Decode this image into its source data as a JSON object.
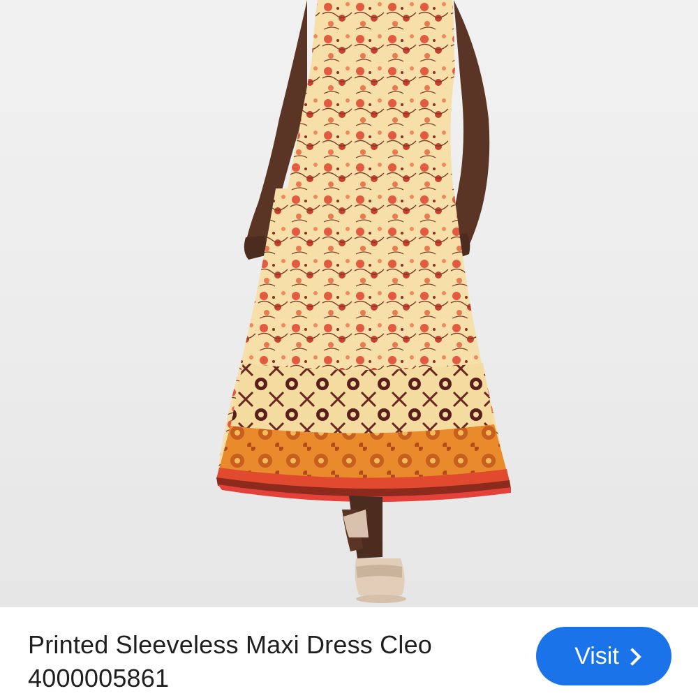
{
  "product": {
    "title_line1": "Printed Sleeveless Maxi Dress Cleo",
    "title_line2": "4000005861",
    "image_alt": "Printed Sleeveless Maxi Dress Cleo"
  },
  "actions": {
    "visit_label": "Visit"
  },
  "colors": {
    "accent": "#1a73e8",
    "dress_base": "#f6dfa9",
    "dress_floral": "#d9533a",
    "dress_border": "#e0862a",
    "skin": "#5a3526"
  },
  "icons": {
    "visit": "chevron-right-icon"
  }
}
